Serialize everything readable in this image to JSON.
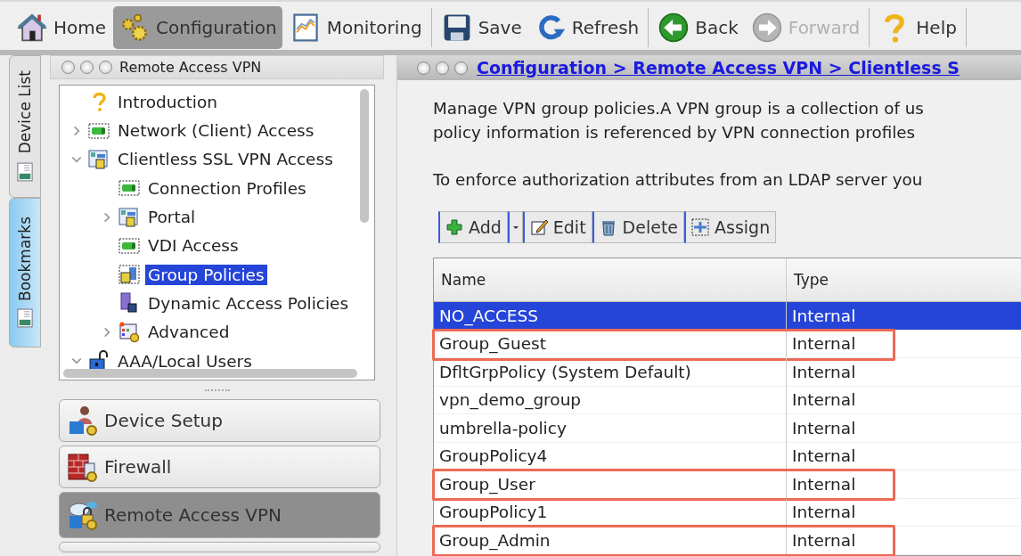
{
  "toolbar": [
    {
      "kind": "home",
      "label": "Home",
      "selected": false,
      "disabled": false
    },
    {
      "kind": "gears",
      "label": "Configuration",
      "selected": true,
      "disabled": false
    },
    {
      "kind": "chart",
      "label": "Monitoring",
      "selected": false,
      "disabled": false,
      "separator": true
    },
    {
      "kind": "disk",
      "label": "Save",
      "selected": false,
      "disabled": false
    },
    {
      "kind": "refresh",
      "label": "Refresh",
      "selected": false,
      "disabled": false,
      "separator": true
    },
    {
      "kind": "back",
      "label": "Back",
      "selected": false,
      "disabled": false
    },
    {
      "kind": "forward",
      "label": "Forward",
      "selected": false,
      "disabled": true,
      "separator": true
    },
    {
      "kind": "help",
      "label": "Help",
      "selected": false,
      "disabled": false,
      "separator": true
    }
  ],
  "side_tabs": [
    {
      "label": "Device List",
      "selected": false
    },
    {
      "label": "Bookmarks",
      "selected": true
    }
  ],
  "nav_panel": {
    "title": "Remote Access VPN",
    "tree": [
      {
        "kind": "help",
        "label": "Introduction",
        "selected": false
      },
      {
        "kind": "plug",
        "label": "Network (Client) Access",
        "expanded": false,
        "selected": false
      },
      {
        "kind": "portal",
        "label": "Clientless SSL VPN Access",
        "expanded": true,
        "selected": false,
        "children": [
          {
            "kind": "plug",
            "label": "Connection Profiles",
            "selected": false
          },
          {
            "kind": "portal",
            "label": "Portal",
            "expanded": false,
            "selected": false
          },
          {
            "kind": "plug",
            "label": "VDI Access",
            "selected": false
          },
          {
            "kind": "group",
            "label": "Group Policies",
            "selected": true
          },
          {
            "kind": "door",
            "label": "Dynamic Access Policies",
            "selected": false
          },
          {
            "kind": "advanced",
            "label": "Advanced",
            "expanded": false,
            "selected": false
          }
        ]
      },
      {
        "kind": "lock",
        "label": "AAA/Local Users",
        "expanded": true,
        "selected": false
      }
    ],
    "sections": [
      {
        "kind": "device",
        "label": "Device Setup",
        "selected": false
      },
      {
        "kind": "firewall",
        "label": "Firewall",
        "selected": false
      },
      {
        "kind": "vpn",
        "label": "Remote Access VPN",
        "selected": true
      }
    ]
  },
  "content": {
    "breadcrumb": "Configuration > Remote Access VPN > Clientless S",
    "description": [
      "Manage VPN group policies.A VPN group is a collection of us",
      "policy information is referenced by VPN connection profiles"
    ],
    "note": "To enforce authorization attributes from an LDAP server you",
    "actions": [
      {
        "kind": "add",
        "label": "Add"
      },
      {
        "kind": "edit",
        "label": "Edit"
      },
      {
        "kind": "delete",
        "label": "Delete"
      },
      {
        "kind": "assign",
        "label": "Assign"
      }
    ],
    "table": {
      "columns": [
        "Name",
        "Type"
      ],
      "rows": [
        {
          "name": "NO_ACCESS",
          "type": "Internal",
          "selected": true,
          "outlined": false
        },
        {
          "name": "Group_Guest",
          "type": "Internal",
          "selected": false,
          "outlined": true
        },
        {
          "name": "DfltGrpPolicy (System Default)",
          "type": "Internal",
          "selected": false,
          "outlined": false
        },
        {
          "name": "vpn_demo_group",
          "type": "Internal",
          "selected": false,
          "outlined": false
        },
        {
          "name": "umbrella-policy",
          "type": "Internal",
          "selected": false,
          "outlined": false
        },
        {
          "name": "GroupPolicy4",
          "type": "Internal",
          "selected": false,
          "outlined": false
        },
        {
          "name": "Group_User",
          "type": "Internal",
          "selected": false,
          "outlined": true
        },
        {
          "name": "GroupPolicy1",
          "type": "Internal",
          "selected": false,
          "outlined": false
        },
        {
          "name": "Group_Admin",
          "type": "Internal",
          "selected": false,
          "outlined": true
        }
      ]
    }
  }
}
